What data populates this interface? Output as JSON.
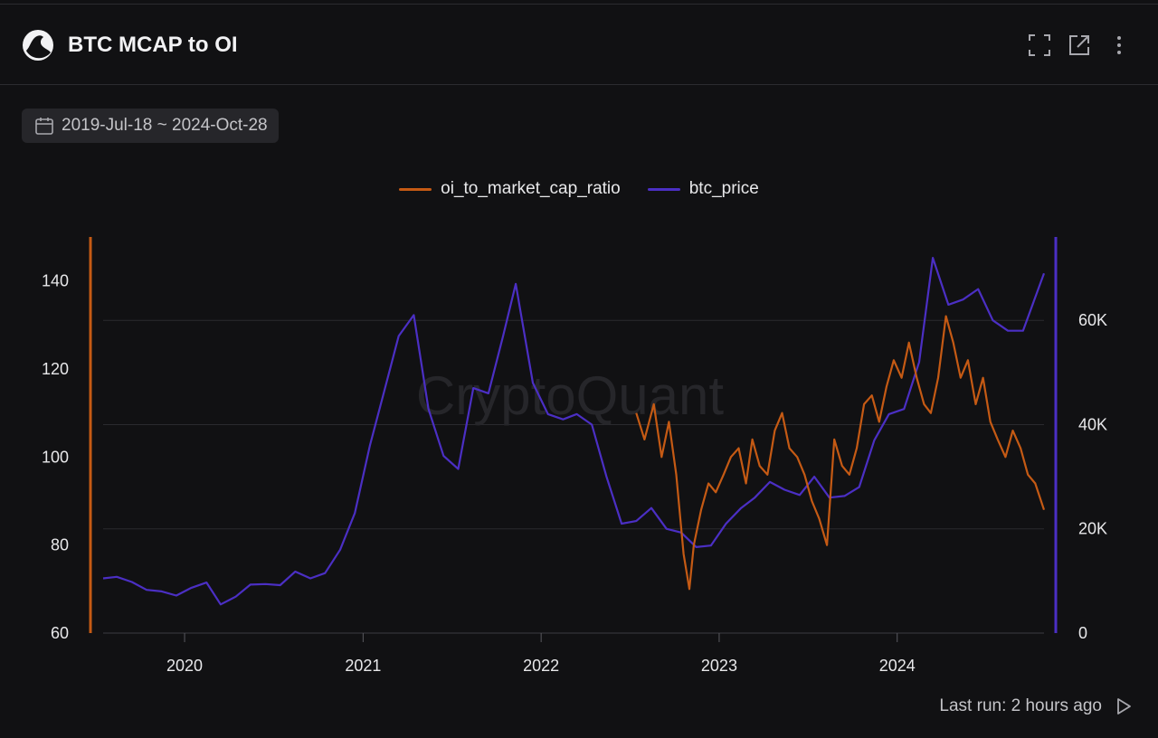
{
  "header": {
    "title": "BTC MCAP to OI",
    "icons": [
      "fullscreen-icon",
      "external-link-icon",
      "more-vertical-icon"
    ]
  },
  "toolbar": {
    "date_range": "2019-Jul-18 ~ 2024-Oct-28"
  },
  "footer": {
    "last_run": "Last run: 2 hours ago"
  },
  "watermark": "CryptoQuant",
  "chart_data": {
    "type": "line",
    "title": "",
    "legend_position": "top-center",
    "grid": true,
    "x_range": [
      "2019-07-18",
      "2024-10-28"
    ],
    "x_ticks": [
      "2020",
      "2021",
      "2022",
      "2023",
      "2024"
    ],
    "left_axis": {
      "min": 60,
      "max": 150,
      "ticks": [
        "60",
        "80",
        "100",
        "120",
        "140"
      ],
      "color": "#c55a14"
    },
    "right_axis": {
      "min": 0,
      "max": 76000,
      "ticks": [
        "0",
        "20K",
        "40K",
        "60K"
      ],
      "color": "#4b2fc4"
    },
    "series": [
      {
        "name": "oi_to_market_cap_ratio",
        "axis": "left",
        "color": "#c55a14",
        "x": [
          "2022-07-15",
          "2022-08-01",
          "2022-08-20",
          "2022-09-05",
          "2022-09-20",
          "2022-10-05",
          "2022-10-20",
          "2022-11-01",
          "2022-11-10",
          "2022-11-25",
          "2022-12-10",
          "2022-12-25",
          "2023-01-10",
          "2023-01-25",
          "2023-02-10",
          "2023-02-25",
          "2023-03-10",
          "2023-03-25",
          "2023-04-10",
          "2023-04-25",
          "2023-05-10",
          "2023-05-25",
          "2023-06-10",
          "2023-06-25",
          "2023-07-10",
          "2023-07-25",
          "2023-08-10",
          "2023-08-25",
          "2023-09-10",
          "2023-09-25",
          "2023-10-10",
          "2023-10-25",
          "2023-11-10",
          "2023-11-25",
          "2023-12-10",
          "2023-12-25",
          "2024-01-10",
          "2024-01-25",
          "2024-02-10",
          "2024-02-25",
          "2024-03-10",
          "2024-03-25",
          "2024-04-10",
          "2024-04-25",
          "2024-05-10",
          "2024-05-25",
          "2024-06-10",
          "2024-06-25",
          "2024-07-10",
          "2024-07-25",
          "2024-08-10",
          "2024-08-25",
          "2024-09-10",
          "2024-09-25",
          "2024-10-10",
          "2024-10-28"
        ],
        "y": [
          110,
          104,
          112,
          100,
          108,
          96,
          78,
          70,
          80,
          88,
          94,
          92,
          96,
          100,
          102,
          94,
          104,
          98,
          96,
          106,
          110,
          102,
          100,
          96,
          90,
          86,
          80,
          104,
          98,
          96,
          102,
          112,
          114,
          108,
          116,
          122,
          118,
          126,
          118,
          112,
          110,
          118,
          132,
          126,
          118,
          122,
          112,
          118,
          108,
          104,
          100,
          106,
          102,
          96,
          94,
          88
        ]
      },
      {
        "name": "btc_price",
        "axis": "right",
        "color": "#4b2fc4",
        "x": [
          "2019-07-18",
          "2019-08-15",
          "2019-09-15",
          "2019-10-15",
          "2019-11-15",
          "2019-12-15",
          "2020-01-15",
          "2020-02-15",
          "2020-03-15",
          "2020-04-15",
          "2020-05-15",
          "2020-06-15",
          "2020-07-15",
          "2020-08-15",
          "2020-09-15",
          "2020-10-15",
          "2020-11-15",
          "2020-12-15",
          "2021-01-15",
          "2021-02-15",
          "2021-03-15",
          "2021-04-15",
          "2021-05-15",
          "2021-06-15",
          "2021-07-15",
          "2021-08-15",
          "2021-09-15",
          "2021-10-15",
          "2021-11-10",
          "2021-12-15",
          "2022-01-15",
          "2022-02-15",
          "2022-03-15",
          "2022-04-15",
          "2022-05-15",
          "2022-06-15",
          "2022-07-15",
          "2022-08-15",
          "2022-09-15",
          "2022-10-15",
          "2022-11-15",
          "2022-12-15",
          "2023-01-15",
          "2023-02-15",
          "2023-03-15",
          "2023-04-15",
          "2023-05-15",
          "2023-06-15",
          "2023-07-15",
          "2023-08-15",
          "2023-09-15",
          "2023-10-15",
          "2023-11-15",
          "2023-12-15",
          "2024-01-15",
          "2024-02-15",
          "2024-03-14",
          "2024-04-15",
          "2024-05-15",
          "2024-06-15",
          "2024-07-15",
          "2024-08-15",
          "2024-09-15",
          "2024-10-28"
        ],
        "y": [
          10500,
          10800,
          9800,
          8300,
          8000,
          7200,
          8700,
          9700,
          5500,
          7000,
          9300,
          9400,
          9200,
          11800,
          10500,
          11500,
          16000,
          23000,
          36000,
          47000,
          57000,
          61000,
          43000,
          34000,
          31500,
          47000,
          46000,
          57000,
          67000,
          48000,
          42000,
          41000,
          42000,
          40000,
          30000,
          21000,
          21500,
          24000,
          20000,
          19300,
          16500,
          16800,
          21000,
          24000,
          26000,
          29000,
          27500,
          26500,
          30000,
          26000,
          26300,
          28000,
          37000,
          42000,
          43000,
          52000,
          72000,
          63000,
          64000,
          66000,
          60000,
          58000,
          58000,
          69000
        ]
      }
    ]
  }
}
